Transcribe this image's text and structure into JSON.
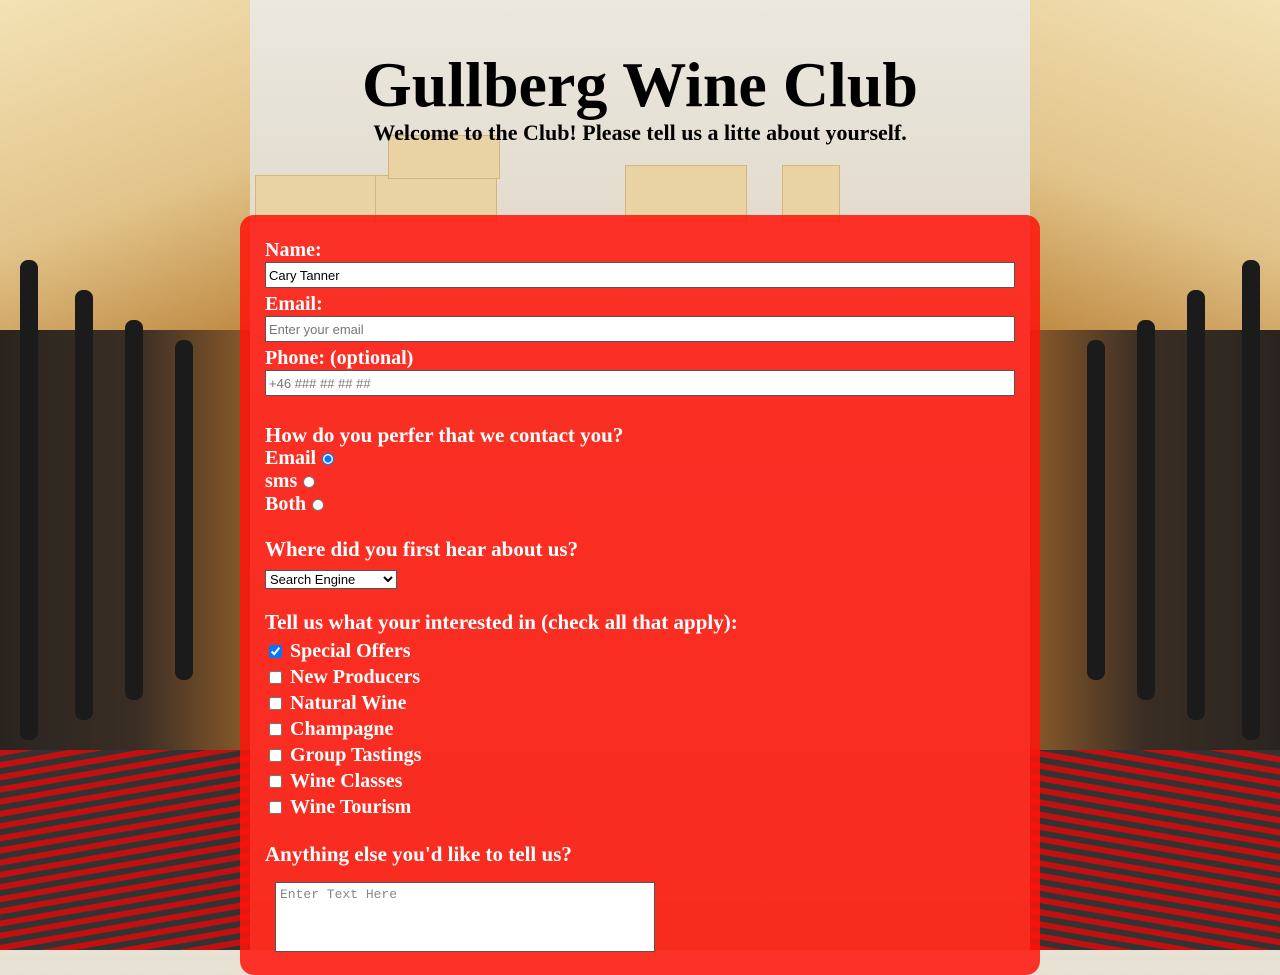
{
  "page": {
    "title": "Gullberg Wine Club",
    "subtitle": "Welcome to the Club! Please tell us a litte about yourself."
  },
  "form": {
    "name": {
      "label": "Name:",
      "value": "Cary Tanner"
    },
    "email": {
      "label": "Email:",
      "placeholder": "Enter your email"
    },
    "phone": {
      "label": "Phone: (optional)",
      "placeholder": "+46 ### ## ## ##"
    },
    "contact": {
      "question": "How do you perfer that we contact you?",
      "options": [
        {
          "label": "Email",
          "checked": true
        },
        {
          "label": "sms",
          "checked": false
        },
        {
          "label": "Both",
          "checked": false
        }
      ]
    },
    "source": {
      "question": "Where did you first hear about us?",
      "selected": "Search Engine"
    },
    "interests": {
      "question": "Tell us what your interested in (check all that apply):",
      "options": [
        {
          "label": "Special Offers",
          "checked": true
        },
        {
          "label": "New Producers",
          "checked": false
        },
        {
          "label": "Natural Wine",
          "checked": false
        },
        {
          "label": "Champagne",
          "checked": false
        },
        {
          "label": "Group Tastings",
          "checked": false
        },
        {
          "label": "Wine Classes",
          "checked": false
        },
        {
          "label": "Wine Tourism",
          "checked": false
        }
      ]
    },
    "comments": {
      "question": "Anything else you'd like to tell us?",
      "placeholder": "Enter Text Here"
    }
  },
  "colors": {
    "card": "#ff140a",
    "text_on_card": "#ffffff"
  }
}
